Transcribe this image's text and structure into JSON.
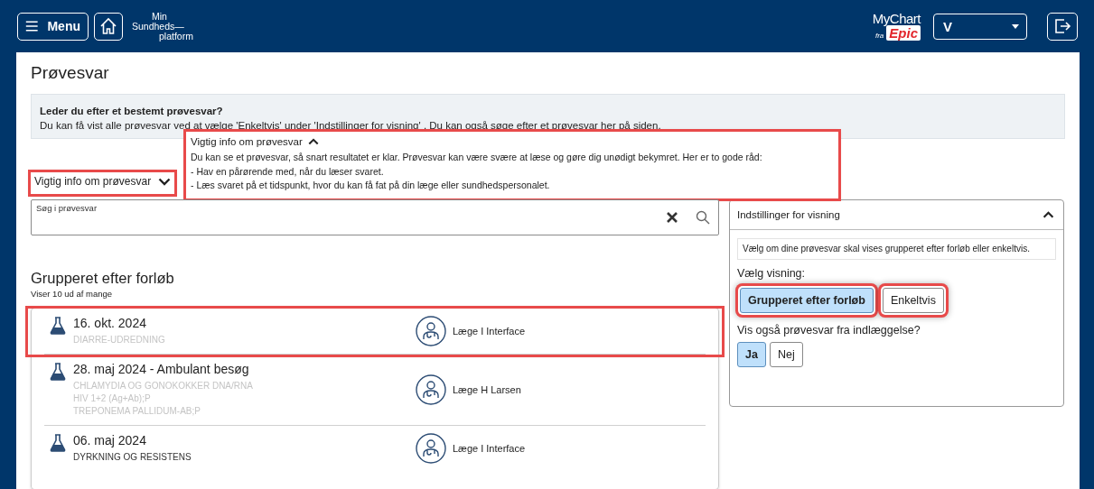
{
  "header": {
    "menu_label": "Menu",
    "brand_lines": [
      "Min",
      "Sundheds—",
      "platform"
    ],
    "logo": {
      "top": "MyChart",
      "fra": "fra",
      "epic": "Epic"
    },
    "user_select": "V"
  },
  "page_title": "Prøvesvar",
  "info_box": {
    "title": "Leder du efter et bestemt prøvesvar?",
    "text": "Du kan få vist alle prøvesvar ved at vælge 'Enkeltvis' under 'Indstillinger for visning' . Du kan også søge efter et prøvesvar her på siden."
  },
  "info_toggle": {
    "label": "Vigtig info om prøvesvar",
    "expanded": false,
    "highlighted": true
  },
  "info_popover": {
    "label": "Vigtig info om prøvesvar",
    "expanded": true,
    "highlighted": true,
    "lines": [
      "Du kan se et prøvesvar, så snart resultatet er klar. Prøvesvar kan være svære at læse og gøre dig unødigt bekymret. Her er to gode råd:",
      "- Hav en pårørende med, når du læser svaret.",
      "- Læs svaret på et tidspunkt, hvor du kan få fat på din læge eller sundhedspersonalet."
    ]
  },
  "search": {
    "placeholder": "Søg i prøvesvar"
  },
  "group": {
    "title": "Grupperet efter forløb",
    "subtitle": "Viser 10 ud af mange"
  },
  "results": [
    {
      "date": "16. okt. 2024",
      "tests": [
        "DIARRE-UDREDNING"
      ],
      "faded": true,
      "doctor": "Læge I Interface",
      "highlighted": true
    },
    {
      "date": "28. maj 2024 - Ambulant besøg",
      "tests": [
        "CHLAMYDIA OG GONOKOKKER DNA/RNA",
        "HIV 1+2 (Ag+Ab);P",
        "TREPONEMA PALLIDUM-AB;P"
      ],
      "faded": true,
      "doctor": "Læge H Larsen",
      "highlighted": false
    },
    {
      "date": "06. maj 2024",
      "tests": [
        "DYRKNING OG RESISTENS"
      ],
      "faded": false,
      "doctor": "Læge I Interface",
      "highlighted": false
    }
  ],
  "settings": {
    "title": "Indstillinger for visning",
    "expanded": true,
    "description": "Vælg om dine prøvesvar skal vises grupperet efter forløb eller enkeltvis.",
    "view_label": "Vælg visning:",
    "view_options": [
      {
        "label": "Grupperet efter forløb",
        "selected": true,
        "highlighted": true
      },
      {
        "label": "Enkeltvis",
        "selected": false,
        "highlighted": true
      }
    ],
    "inpatient_label": "Vis også prøvesvar fra indlæggelse?",
    "inpatient_options": [
      {
        "label": "Ja",
        "selected": true
      },
      {
        "label": "Nej",
        "selected": false
      }
    ]
  }
}
